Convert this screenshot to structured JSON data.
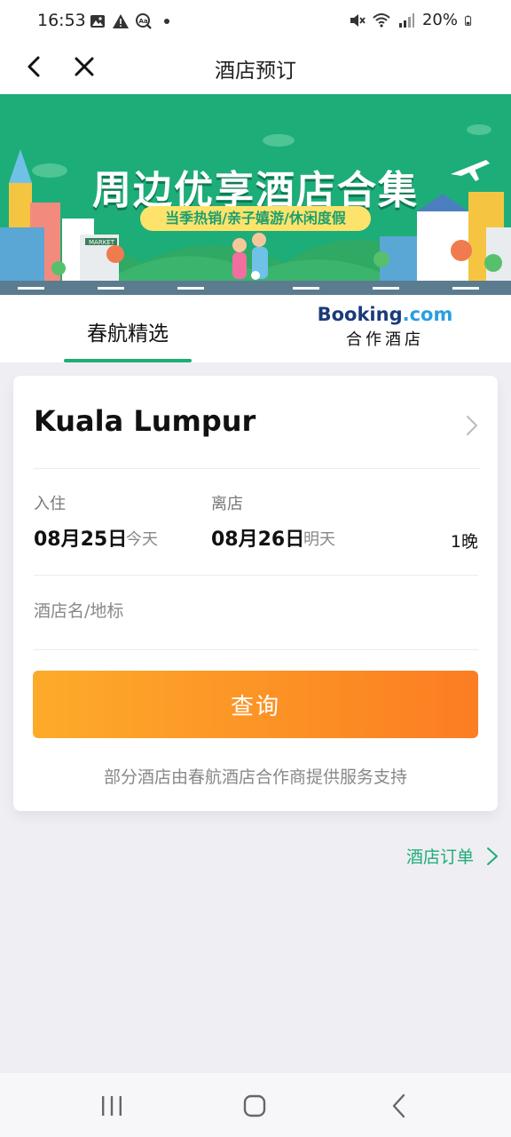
{
  "status_bar": {
    "time": "16:53",
    "battery": "20%",
    "left_icons": [
      "image-icon",
      "alert-icon",
      "translate-icon",
      "dot-icon"
    ],
    "right_icons": [
      "mute-icon",
      "wifi-icon",
      "signal-icon",
      "battery-icon"
    ]
  },
  "nav": {
    "title": "酒店预订"
  },
  "banner": {
    "title": "周边优享酒店合集",
    "subtitle": "当季热销/亲子嬉游/休闲度假",
    "street_sign": "MARKET"
  },
  "tabs": [
    {
      "label": "春航精选",
      "selected": true
    },
    {
      "logo_primary": "Booking",
      "logo_suffix": ".com",
      "label": "合作酒店",
      "selected": false
    }
  ],
  "search_card": {
    "city": "Kuala Lumpur",
    "checkin_label": "入住",
    "checkin_date": "08月25日",
    "checkin_relative": "今天",
    "checkout_label": "离店",
    "checkout_date": "08月26日",
    "checkout_relative": "明天",
    "nights": "1晚",
    "hotel_placeholder": "酒店名/地标",
    "query_button": "查询",
    "disclaimer": "部分酒店由春航酒店合作商提供服务支持"
  },
  "orders_link": {
    "label": "酒店订单"
  },
  "colors": {
    "brand_green": "#1dad79",
    "button_start": "#fdab2a",
    "button_end": "#fc7d22",
    "page_bg": "#efeef3"
  }
}
